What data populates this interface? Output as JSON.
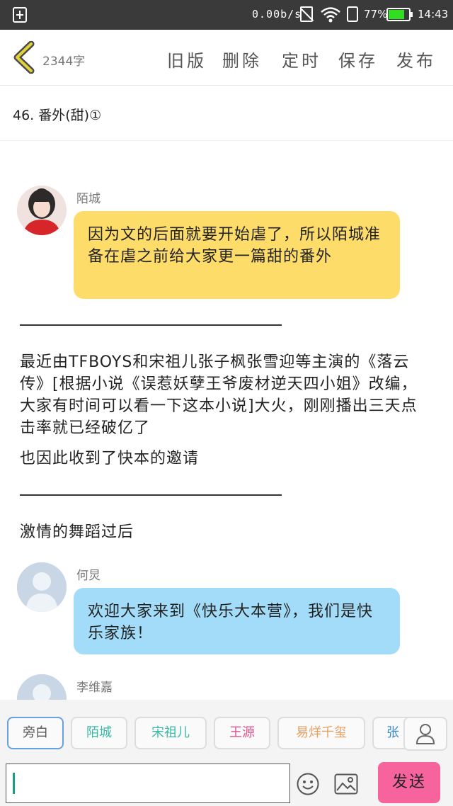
{
  "status_bar": {
    "network_speed": "0.00b/s",
    "battery_percent_label": "77%",
    "battery_level": 0.77,
    "battery_color": "#33dd22",
    "time": "14:43"
  },
  "toolbar": {
    "back_icon": "chevron-left-icon",
    "word_count": "2344字",
    "old_version": "旧版",
    "delete": "删除",
    "schedule": "定时",
    "save": "保存",
    "publish": "发布"
  },
  "chapter": {
    "title": "46. 番外(甜)①"
  },
  "messages": [
    {
      "speaker": "陌城",
      "text": "因为文的后面就要开始虐了，所以陌城准备在虐之前给大家更一篇甜的番外",
      "bubble_color": "#fedc6a"
    },
    {
      "speaker": "何炅",
      "text": "欢迎大家来到《快乐大本营》，我们是快乐家族！",
      "bubble_color": "#a3dcf8"
    },
    {
      "speaker": "李维嘉"
    }
  ],
  "narration": {
    "divider_1": "——————————————————",
    "paragraph_1": "最近由TFBOYS和宋祖儿张子枫张雪迎等主演的《落云传》[根据小说《误惹妖孽王爷废材逆天四小姐》改编，大家有时间可以看一下这本小说]大火，刚刚播出三天点击率就已经破亿了",
    "paragraph_2": "也因此收到了快本的邀请",
    "divider_2": "——————————————————",
    "paragraph_3": "激情的舞蹈过后"
  },
  "character_chips": [
    {
      "label": "旁白",
      "color": "#555555",
      "border": "#6a9fe0"
    },
    {
      "label": "陌城",
      "color": "#3ab8a8",
      "border": "#dddddd"
    },
    {
      "label": "宋祖儿",
      "color": "#3ab8a8",
      "border": "#dddddd"
    },
    {
      "label": "王源",
      "color": "#e0548a",
      "border": "#dddddd"
    },
    {
      "label": "易烊千玺",
      "color": "#e8a060",
      "border": "#dddddd"
    },
    {
      "label": "张",
      "color": "#3a8ad0",
      "border": "#dddddd"
    }
  ],
  "composer": {
    "input_value": "",
    "emoji_icon": "smiley-icon",
    "image_icon": "image-icon",
    "person_icon": "person-icon",
    "send_label": "发送",
    "send_color": "#f7639c"
  }
}
